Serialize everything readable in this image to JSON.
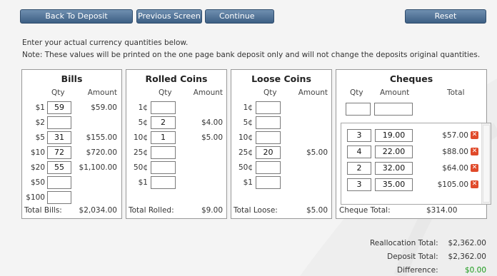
{
  "toolbar": {
    "back_label": "Back To Deposit",
    "previous_label": "Previous Screen",
    "continue_label": "Continue",
    "reset_label": "Reset"
  },
  "intro": {
    "line1": "Enter your actual currency quantities below.",
    "line2": "Note: These values will be printed on the one page bank deposit only and will not change the deposits original quantities."
  },
  "bills": {
    "title": "Bills",
    "qty_header": "Qty",
    "amount_header": "Amount",
    "rows": [
      {
        "label": "$1",
        "qty": "59",
        "amount": "$59.00"
      },
      {
        "label": "$2",
        "qty": "",
        "amount": ""
      },
      {
        "label": "$5",
        "qty": "31",
        "amount": "$155.00"
      },
      {
        "label": "$10",
        "qty": "72",
        "amount": "$720.00"
      },
      {
        "label": "$20",
        "qty": "55",
        "amount": "$1,100.00"
      },
      {
        "label": "$50",
        "qty": "",
        "amount": ""
      },
      {
        "label": "$100",
        "qty": "",
        "amount": ""
      }
    ],
    "total_label": "Total Bills:",
    "total_value": "$2,034.00"
  },
  "rolled": {
    "title": "Rolled Coins",
    "qty_header": "Qty",
    "amount_header": "Amount",
    "rows": [
      {
        "label": "1¢",
        "qty": "",
        "amount": ""
      },
      {
        "label": "5¢",
        "qty": "2",
        "amount": "$4.00"
      },
      {
        "label": "10¢",
        "qty": "1",
        "amount": "$5.00"
      },
      {
        "label": "25¢",
        "qty": "",
        "amount": ""
      },
      {
        "label": "50¢",
        "qty": "",
        "amount": ""
      },
      {
        "label": "$1",
        "qty": "",
        "amount": ""
      }
    ],
    "total_label": "Total Rolled:",
    "total_value": "$9.00"
  },
  "loose": {
    "title": "Loose Coins",
    "qty_header": "Qty",
    "amount_header": "Amount",
    "rows": [
      {
        "label": "1¢",
        "qty": "",
        "amount": ""
      },
      {
        "label": "5¢",
        "qty": "",
        "amount": ""
      },
      {
        "label": "10¢",
        "qty": "",
        "amount": ""
      },
      {
        "label": "25¢",
        "qty": "20",
        "amount": "$5.00"
      },
      {
        "label": "50¢",
        "qty": "",
        "amount": ""
      },
      {
        "label": "$1",
        "qty": "",
        "amount": ""
      }
    ],
    "total_label": "Total Loose:",
    "total_value": "$5.00"
  },
  "cheques": {
    "title": "Cheques",
    "qty_header": "Qty",
    "amount_header": "Amount",
    "total_header": "Total",
    "new_qty": "",
    "new_amount": "",
    "rows": [
      {
        "qty": "3",
        "amount": "19.00",
        "total": "$57.00"
      },
      {
        "qty": "4",
        "amount": "22.00",
        "total": "$88.00"
      },
      {
        "qty": "2",
        "amount": "32.00",
        "total": "$64.00"
      },
      {
        "qty": "3",
        "amount": "35.00",
        "total": "$105.00"
      }
    ],
    "remove_glyph": "✕",
    "total_label": "Cheque Total:",
    "total_value": "$314.00"
  },
  "summary": {
    "reallocation_label": "Reallocation Total:",
    "reallocation_value": "$2,362.00",
    "deposit_label": "Deposit Total:",
    "deposit_value": "$2,362.00",
    "difference_label": "Difference:",
    "difference_value": "$0.00"
  },
  "colors": {
    "button": "#4a6b8f",
    "remove": "#e04a2a",
    "difference": "#1a9a1a"
  }
}
